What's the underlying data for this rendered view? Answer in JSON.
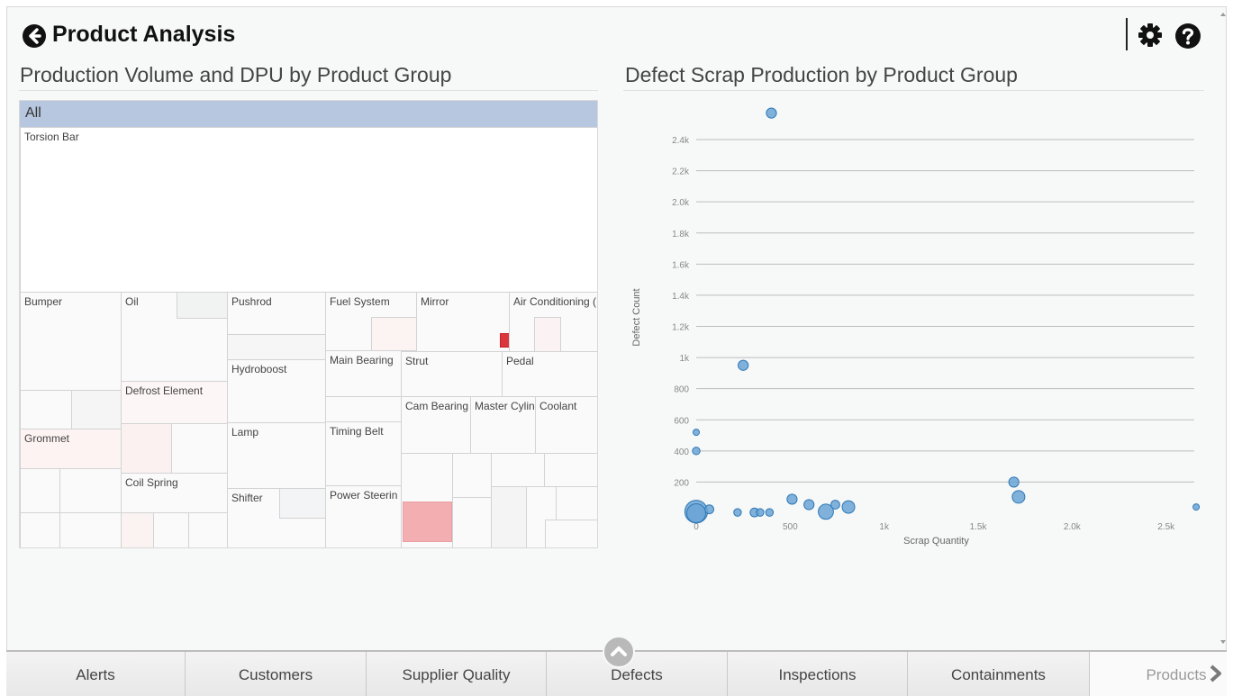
{
  "header": {
    "title": "Product Analysis"
  },
  "left_panel": {
    "title": "Production Volume and DPU by Product Group",
    "root_label": "All",
    "groups": [
      "Torsion Bar",
      "Bumper",
      "Oil",
      "Pushrod",
      "Fuel System",
      "Mirror",
      "Air Conditioning (",
      "Hydroboost",
      "Main Bearing",
      "Strut",
      "Pedal",
      "Defrost Element",
      "Cam Bearing",
      "Master Cylin",
      "Coolant",
      "Grommet",
      "Lamp",
      "Timing Belt",
      "Coil Spring",
      "Shifter",
      "Power Steerin"
    ]
  },
  "right_panel": {
    "title": "Defect Scrap Production by Product Group"
  },
  "chart_data": {
    "type": "scatter",
    "title": "Defect Scrap Production by Product Group",
    "xlabel": "Scrap Quantity",
    "ylabel": "Defect Count",
    "xlim": [
      0,
      2650
    ],
    "ylim": [
      0,
      2400
    ],
    "x_ticks": [
      "0",
      "500",
      "1k",
      "1.5k",
      "2.0k",
      "2.5k"
    ],
    "x_tick_values": [
      0,
      500,
      1000,
      1500,
      2000,
      2500
    ],
    "y_ticks": [
      "200",
      "400",
      "600",
      "800",
      "1k",
      "1.2k",
      "1.4k",
      "1.6k",
      "1.8k",
      "2.0k",
      "2.2k",
      "2.4k"
    ],
    "y_tick_values": [
      200,
      400,
      600,
      800,
      1000,
      1200,
      1400,
      1600,
      1800,
      2000,
      2200,
      2400
    ],
    "grid": true,
    "point_color": "#6aa5d6",
    "points": [
      {
        "x": 400,
        "y": 2570,
        "size": 1.6
      },
      {
        "x": 250,
        "y": 950,
        "size": 1.6
      },
      {
        "x": 0,
        "y": 520,
        "size": 1.0
      },
      {
        "x": 0,
        "y": 400,
        "size": 1.2
      },
      {
        "x": 0,
        "y": 10,
        "size": 3.6
      },
      {
        "x": 0,
        "y": 0,
        "size": 3.0
      },
      {
        "x": 70,
        "y": 25,
        "size": 1.4
      },
      {
        "x": 220,
        "y": 5,
        "size": 1.2
      },
      {
        "x": 310,
        "y": 5,
        "size": 1.4
      },
      {
        "x": 340,
        "y": 5,
        "size": 1.2
      },
      {
        "x": 390,
        "y": 5,
        "size": 1.2
      },
      {
        "x": 510,
        "y": 90,
        "size": 1.6
      },
      {
        "x": 600,
        "y": 55,
        "size": 1.6
      },
      {
        "x": 690,
        "y": 10,
        "size": 2.4
      },
      {
        "x": 740,
        "y": 55,
        "size": 1.4
      },
      {
        "x": 810,
        "y": 40,
        "size": 2.0
      },
      {
        "x": 1690,
        "y": 200,
        "size": 1.6
      },
      {
        "x": 1715,
        "y": 105,
        "size": 2.0
      },
      {
        "x": 2660,
        "y": 40,
        "size": 1.0
      }
    ]
  },
  "tabs": [
    {
      "label": "Alerts"
    },
    {
      "label": "Customers"
    },
    {
      "label": "Supplier Quality"
    },
    {
      "label": "Defects"
    },
    {
      "label": "Inspections"
    },
    {
      "label": "Containments"
    },
    {
      "label": "Products"
    }
  ],
  "colors": {
    "accent_blue": "#b6c7df",
    "bubble": "#6aa5d6",
    "high_dpu": "#d9363e",
    "mid_dpu": "#f2aeb0"
  },
  "icons": {
    "back": "arrow-circle-left-icon",
    "settings": "gear-icon",
    "help": "question-circle-icon",
    "collapse": "chevron-up-icon",
    "next": "chevron-right-icon"
  }
}
